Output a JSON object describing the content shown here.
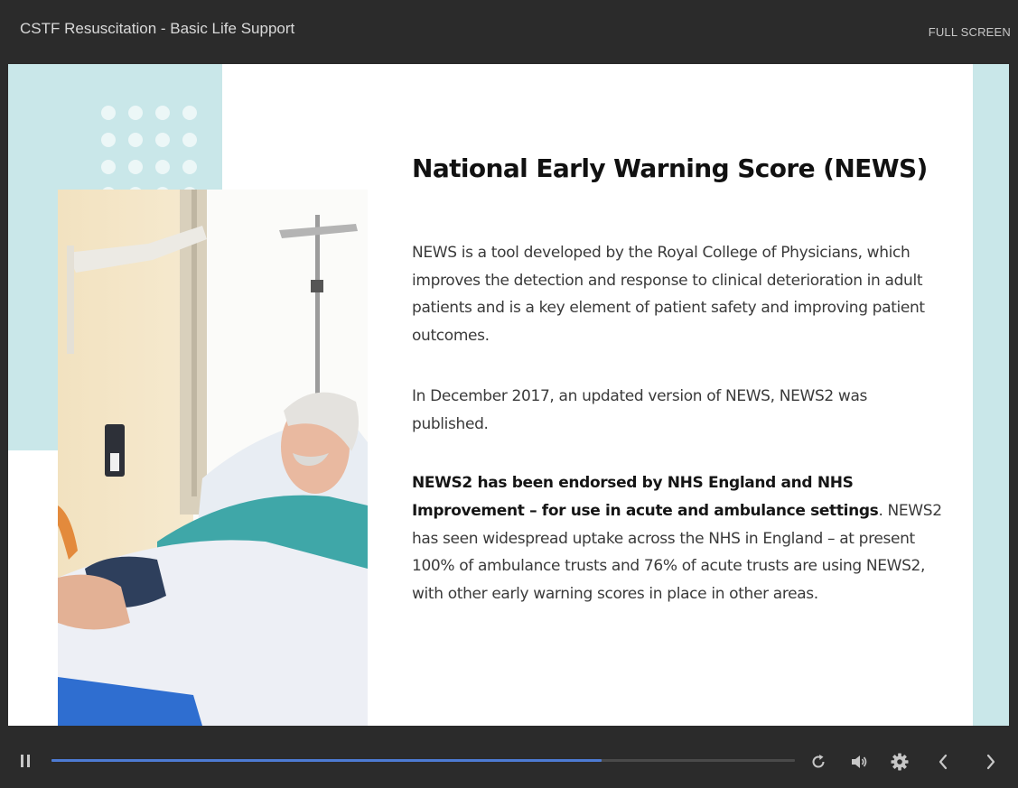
{
  "header": {
    "course_title": "CSTF Resuscitation - Basic Life Support",
    "fullscreen_label": "FULL SCREEN"
  },
  "slide": {
    "title": "National Early Warning Score (NEWS)",
    "paragraph1": "NEWS is a tool developed by the Royal College of Physicians, which improves the detection and response to clinical deterioration in adult patients and is a key element of patient safety and improving patient outcomes.",
    "paragraph2": "In December 2017, an updated version of NEWS, NEWS2 was published.",
    "paragraph3_bold": "NEWS2 has been endorsed by NHS England and NHS Improvement – for use in acute and ambulance settings",
    "paragraph3_rest": ". NEWS2 has seen widespread uptake across the NHS in England – at present 100% of ambulance trusts and 76% of acute trusts are using NEWS2, with other early warning scores in place in other areas.",
    "image_subject": "patient-in-hospital-bed-photo"
  },
  "player": {
    "progress": 0.74,
    "icons": [
      "pause-icon",
      "replay-icon",
      "volume-icon",
      "gear-icon",
      "chevron-left-icon",
      "chevron-right-icon"
    ]
  },
  "colors": {
    "background": "#2b2b2b",
    "accent_teal": "#c9e7e9",
    "progress_fill": "#4d7bd3"
  }
}
